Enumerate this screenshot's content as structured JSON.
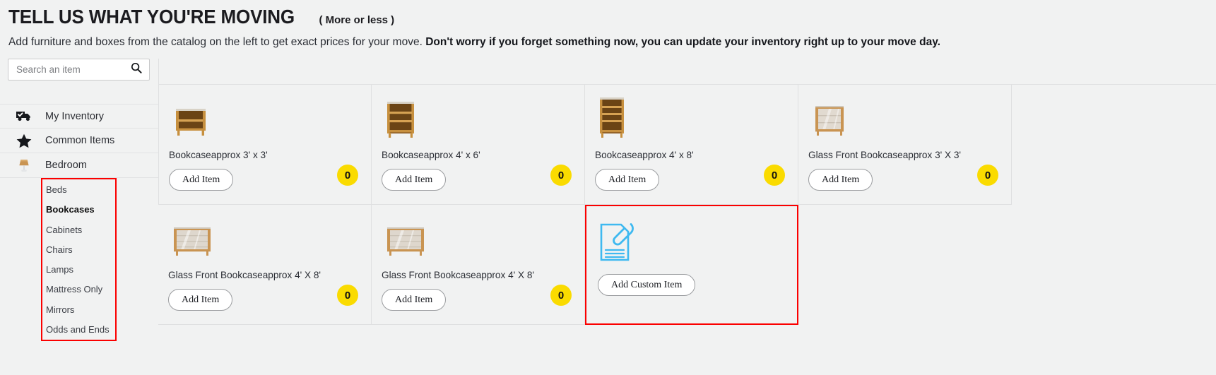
{
  "header": {
    "title": "TELL US WHAT YOU'RE MOVING",
    "title_suffix": "( More or less  )",
    "subtitle_plain": "Add furniture and boxes from the catalog on the left to get exact prices for your move. ",
    "subtitle_bold": "Don't worry if you forget something now, you can update your inventory right up to your move day."
  },
  "sidebar": {
    "search": {
      "placeholder": "Search an item",
      "icon": "search-icon"
    },
    "nav": [
      {
        "label": "My Inventory",
        "icon": "truck-icon"
      },
      {
        "label": "Common Items",
        "icon": "star-icon"
      },
      {
        "label": "Bedroom",
        "icon": "lamp-icon"
      }
    ],
    "subcategories": [
      {
        "label": "Beds",
        "selected": false
      },
      {
        "label": "Bookcases",
        "selected": true
      },
      {
        "label": "Cabinets",
        "selected": false
      },
      {
        "label": "Chairs",
        "selected": false
      },
      {
        "label": "Lamps",
        "selected": false
      },
      {
        "label": "Mattress Only",
        "selected": false
      },
      {
        "label": "Mirrors",
        "selected": false
      },
      {
        "label": "Odds and Ends",
        "selected": false
      }
    ]
  },
  "catalog": {
    "add_item_label": "Add Item",
    "add_custom_label": "Add Custom Item",
    "custom_icon": "document-paperclip-icon",
    "items": [
      {
        "name": "Bookcaseapprox 3' x 3'",
        "count": "0",
        "icon": "bookcase-3x3-icon"
      },
      {
        "name": "Bookcaseapprox 4' x 6'",
        "count": "0",
        "icon": "bookcase-4x6-icon"
      },
      {
        "name": "Bookcaseapprox 4' x 8'",
        "count": "0",
        "icon": "bookcase-4x8-icon"
      },
      {
        "name": "Glass Front Bookcaseapprox 3' X 3'",
        "count": "0",
        "icon": "glass-bookcase-3x3-icon"
      },
      {
        "name": "Glass Front Bookcaseapprox 4' X 8'",
        "count": "0",
        "icon": "glass-bookcase-4x8-icon"
      },
      {
        "name": "Glass Front Bookcaseapprox 4' X 8'",
        "count": "0",
        "icon": "glass-bookcase-4x8-icon"
      }
    ]
  },
  "colors": {
    "badge_yellow": "#fadb00",
    "highlight_red": "#fb0000",
    "custom_icon_blue": "#3fb9f0",
    "page_bg": "#f1f2f2"
  }
}
